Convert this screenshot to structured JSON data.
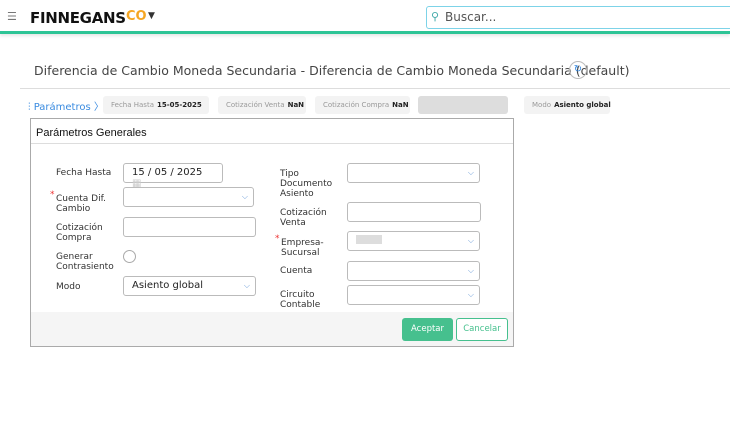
{
  "topbar": {
    "brand": "FINNEGANS",
    "brand_mark": "co",
    "search_placeholder": "Buscar..."
  },
  "page": {
    "title": "Diferencia de Cambio Moneda Secundaria - Diferencia de Cambio Moneda Secundaria (default)"
  },
  "params_bar": {
    "label": "Parámetros",
    "chips": [
      {
        "label": "Fecha Hasta",
        "value": "15-05-2025"
      },
      {
        "label": "Cotización Venta",
        "value": "NaN"
      },
      {
        "label": "Cotización Compra",
        "value": "NaN"
      },
      {
        "label": "Modo",
        "value": "Asiento global"
      }
    ]
  },
  "dialog": {
    "title": "Parámetros Generales",
    "fecha_hasta": {
      "label": "Fecha Hasta",
      "value": "15 / 05 / 2025"
    },
    "cuenta_dif": {
      "label": "Cuenta Dif. Cambio"
    },
    "cot_compra": {
      "label": "Cotización Compra"
    },
    "generar": {
      "label": "Generar Contrasiento",
      "checked": false
    },
    "modo": {
      "label": "Modo",
      "value": "Asiento global"
    },
    "tipo_doc": {
      "label": "Tipo Documento Asiento"
    },
    "cot_venta": {
      "label": "Cotización Venta"
    },
    "empresa": {
      "label": "Empresa-Sucursal"
    },
    "cuenta": {
      "label": "Cuenta"
    },
    "circuito": {
      "label": "Circuito Contable"
    },
    "accept": "Aceptar",
    "cancel": "Cancelar"
  },
  "colors": {
    "accent": "#46c08e",
    "link": "#3a8be0"
  }
}
